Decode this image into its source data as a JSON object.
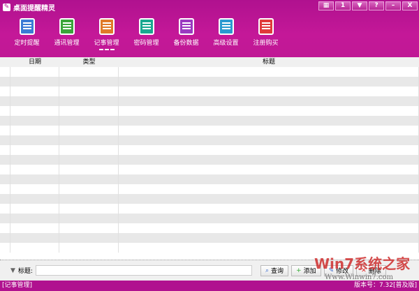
{
  "app": {
    "title": "桌面提醒精灵"
  },
  "window_buttons": [
    {
      "icon": "skin-icon",
      "label": "▦"
    },
    {
      "icon": "calendar-icon",
      "label": "1"
    },
    {
      "icon": "menu-icon",
      "label": "▼"
    },
    {
      "icon": "help-icon",
      "label": "?"
    },
    {
      "icon": "minimize-icon",
      "label": "–"
    },
    {
      "icon": "close-icon",
      "label": "X"
    }
  ],
  "nav": [
    {
      "label": "定时提醒",
      "color": "#3a7bd5"
    },
    {
      "label": "通讯管理",
      "color": "#3aa53a"
    },
    {
      "label": "记事管理",
      "color": "#e07a2a",
      "active": true
    },
    {
      "label": "密码管理",
      "color": "#1aa890"
    },
    {
      "label": "备份数据",
      "color": "#9a3ac0"
    },
    {
      "label": "高级设置",
      "color": "#2a9ad0"
    },
    {
      "label": "注册购买",
      "color": "#e03a3a"
    }
  ],
  "table": {
    "columns": [
      "日期",
      "类型",
      "标题"
    ],
    "row_count": 19
  },
  "search": {
    "label": "标题:",
    "value": "",
    "buttons": [
      "查询",
      "添加",
      "修改",
      "删除"
    ]
  },
  "status": {
    "left": "[记事管理]",
    "right": "版本号：7.32[普及版]"
  },
  "watermark": {
    "text": "Win7系统之家",
    "url": "Www.Winwin7.com"
  }
}
